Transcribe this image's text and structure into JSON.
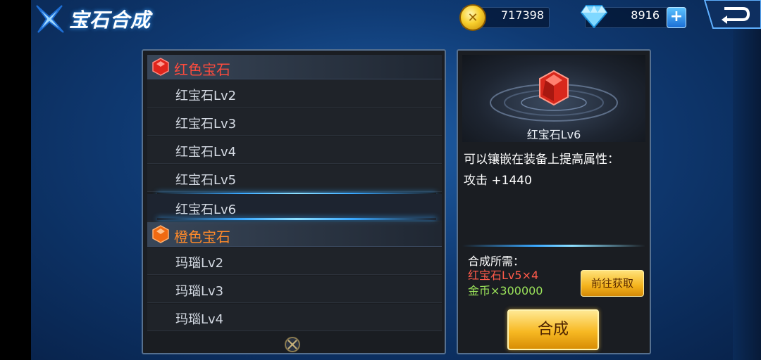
{
  "header": {
    "title": "宝石合成",
    "coin_icon": "gold-coin-icon",
    "coin_value": "717398",
    "diamond_icon": "diamond-icon",
    "diamond_value": "8916",
    "plus_label": "+",
    "back_icon": "back-arrow-icon"
  },
  "list": {
    "categories": [
      {
        "label": "红色宝石",
        "color": "#ff4b3d",
        "icon": "red-gem-icon"
      },
      {
        "label": "橙色宝石",
        "color": "#ff8a2a",
        "icon": "orange-gem-icon"
      }
    ],
    "red_items": [
      "红宝石Lv2",
      "红宝石Lv3",
      "红宝石Lv4",
      "红宝石Lv5",
      "红宝石Lv6"
    ],
    "orange_items": [
      "玛瑙Lv2",
      "玛瑙Lv3",
      "玛瑙Lv4"
    ],
    "selected": "红宝石Lv6"
  },
  "detail": {
    "name": "红宝石Lv6",
    "description": "可以镶嵌在装备上提高属性：",
    "stat": "攻击 +1440",
    "requirement_title": "合成所需：",
    "requirement_gem": "红宝石Lv5×4",
    "requirement_gold": "金币×300000",
    "goto_label": "前往获取",
    "compose_label": "合成"
  }
}
